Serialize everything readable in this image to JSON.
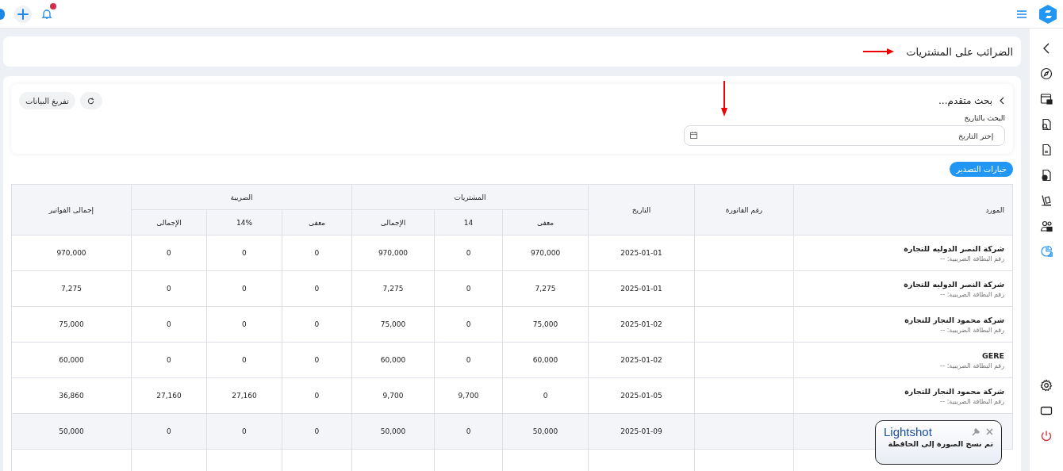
{
  "page_title": "الضرائب على المشتريات",
  "search": {
    "toggle": "بحث متقدم...",
    "expanded": true,
    "date_label": "البحث بالتاريخ",
    "date_placeholder": "إختر التاريخ",
    "clear_button": "تفريغ البيانات"
  },
  "export_button": "خيارات التصدير",
  "table": {
    "columns": {
      "supplier": "المورد",
      "invoice": "رقم الفاتورة",
      "date": "التاريخ",
      "purchases": "المشتريات",
      "tax": "الضريبة",
      "total": "إجمالى الفواتير"
    },
    "sub_columns": {
      "purchases": [
        "معفى",
        "14",
        "الإجمالى"
      ],
      "tax": [
        "معفى",
        "14%",
        "الإجمالى"
      ]
    },
    "rows": [
      {
        "supplier": "شركة النصر الدوليه للتجارة",
        "tax_card": "رقم البطاقة الضريبية: --",
        "date": "2025-01-01",
        "purchases": [
          "970,000",
          "0",
          "970,000"
        ],
        "tax": [
          "0",
          "0",
          "0"
        ],
        "total": "970,000",
        "highlighted": false
      },
      {
        "supplier": "شركة النصر الدوليه للتجارة",
        "tax_card": "رقم البطاقة الضريبية: --",
        "date": "2025-01-01",
        "purchases": [
          "7,275",
          "0",
          "7,275"
        ],
        "tax": [
          "0",
          "0",
          "0"
        ],
        "total": "7,275",
        "highlighted": false
      },
      {
        "supplier": "شركة محمود النجار للتجارة",
        "tax_card": "رقم البطاقة الضريبية: --",
        "date": "2025-01-02",
        "purchases": [
          "75,000",
          "0",
          "75,000"
        ],
        "tax": [
          "0",
          "0",
          "0"
        ],
        "total": "75,000",
        "highlighted": false
      },
      {
        "supplier": "GERE",
        "tax_card": "رقم البطاقة الضريبية: --",
        "date": "2025-01-02",
        "purchases": [
          "60,000",
          "0",
          "60,000"
        ],
        "tax": [
          "0",
          "0",
          "0"
        ],
        "total": "60,000",
        "highlighted": false
      },
      {
        "supplier": "شركة محمود النجار للتجارة",
        "tax_card": "رقم البطاقة الضريبية: --",
        "date": "2025-01-05",
        "purchases": [
          "0",
          "9,700",
          "9,700"
        ],
        "tax": [
          "0",
          "27,160",
          "27,160"
        ],
        "total": "36,860",
        "highlighted": false
      },
      {
        "date": "2025-01-09",
        "purchases": [
          "50,000",
          "0",
          "50,000"
        ],
        "tax": [
          "0",
          "0",
          "0"
        ],
        "total": "50,000",
        "highlighted": true
      }
    ]
  },
  "sidebar": {
    "items": [
      {
        "selected": false
      },
      {
        "selected": false
      },
      {
        "selected": false
      },
      {
        "selected": false
      },
      {
        "selected": false
      },
      {
        "selected": false
      },
      {
        "selected": false
      },
      {
        "selected": true
      }
    ]
  },
  "toast": {
    "title": "Lightshot",
    "message": "تم نسخ الصورة إلى الحافظة"
  }
}
